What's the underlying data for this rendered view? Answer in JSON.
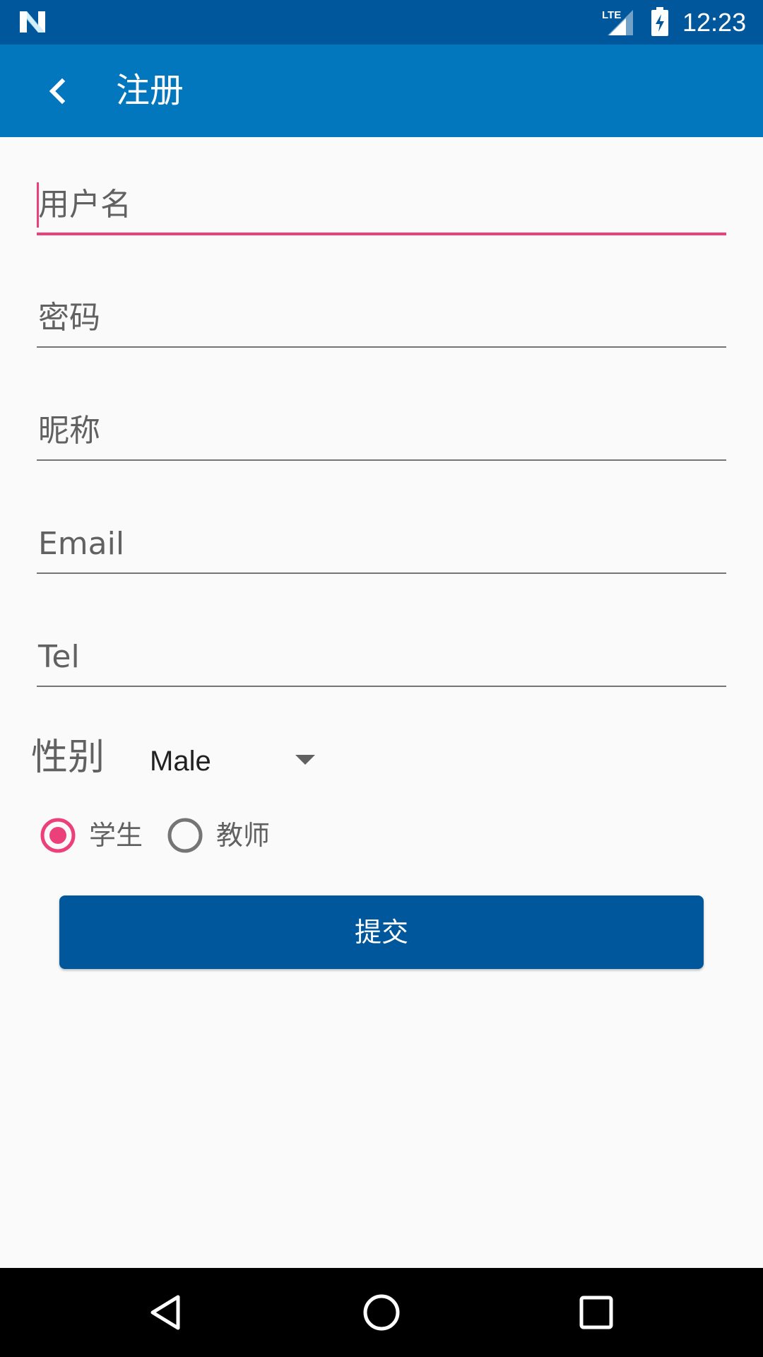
{
  "status_bar": {
    "time": "12:23",
    "network_label": "LTE",
    "icons": [
      "notification-n-icon",
      "lte-signal-icon",
      "battery-charging-icon"
    ]
  },
  "toolbar": {
    "title": "注册",
    "back_icon": "back-arrow-icon"
  },
  "form": {
    "fields": [
      {
        "placeholder": "用户名",
        "value": "",
        "focused": true
      },
      {
        "placeholder": "密码",
        "value": "",
        "focused": false
      },
      {
        "placeholder": "昵称",
        "value": "",
        "focused": false
      },
      {
        "placeholder": "Email",
        "value": "",
        "focused": false
      },
      {
        "placeholder": "Tel",
        "value": "",
        "focused": false
      }
    ],
    "gender_label": "性别",
    "gender_selected": "Male",
    "role_options": [
      {
        "label": "学生",
        "checked": true
      },
      {
        "label": "教师",
        "checked": false
      }
    ],
    "submit_label": "提交"
  },
  "nav_bar": {
    "icons": [
      "back-triangle-icon",
      "home-circle-icon",
      "recents-square-icon"
    ]
  },
  "colors": {
    "status_bar": "#01579B",
    "toolbar": "#0277BD",
    "accent": "#EC407A",
    "button": "#01579B",
    "background": "#FAFAFA"
  }
}
